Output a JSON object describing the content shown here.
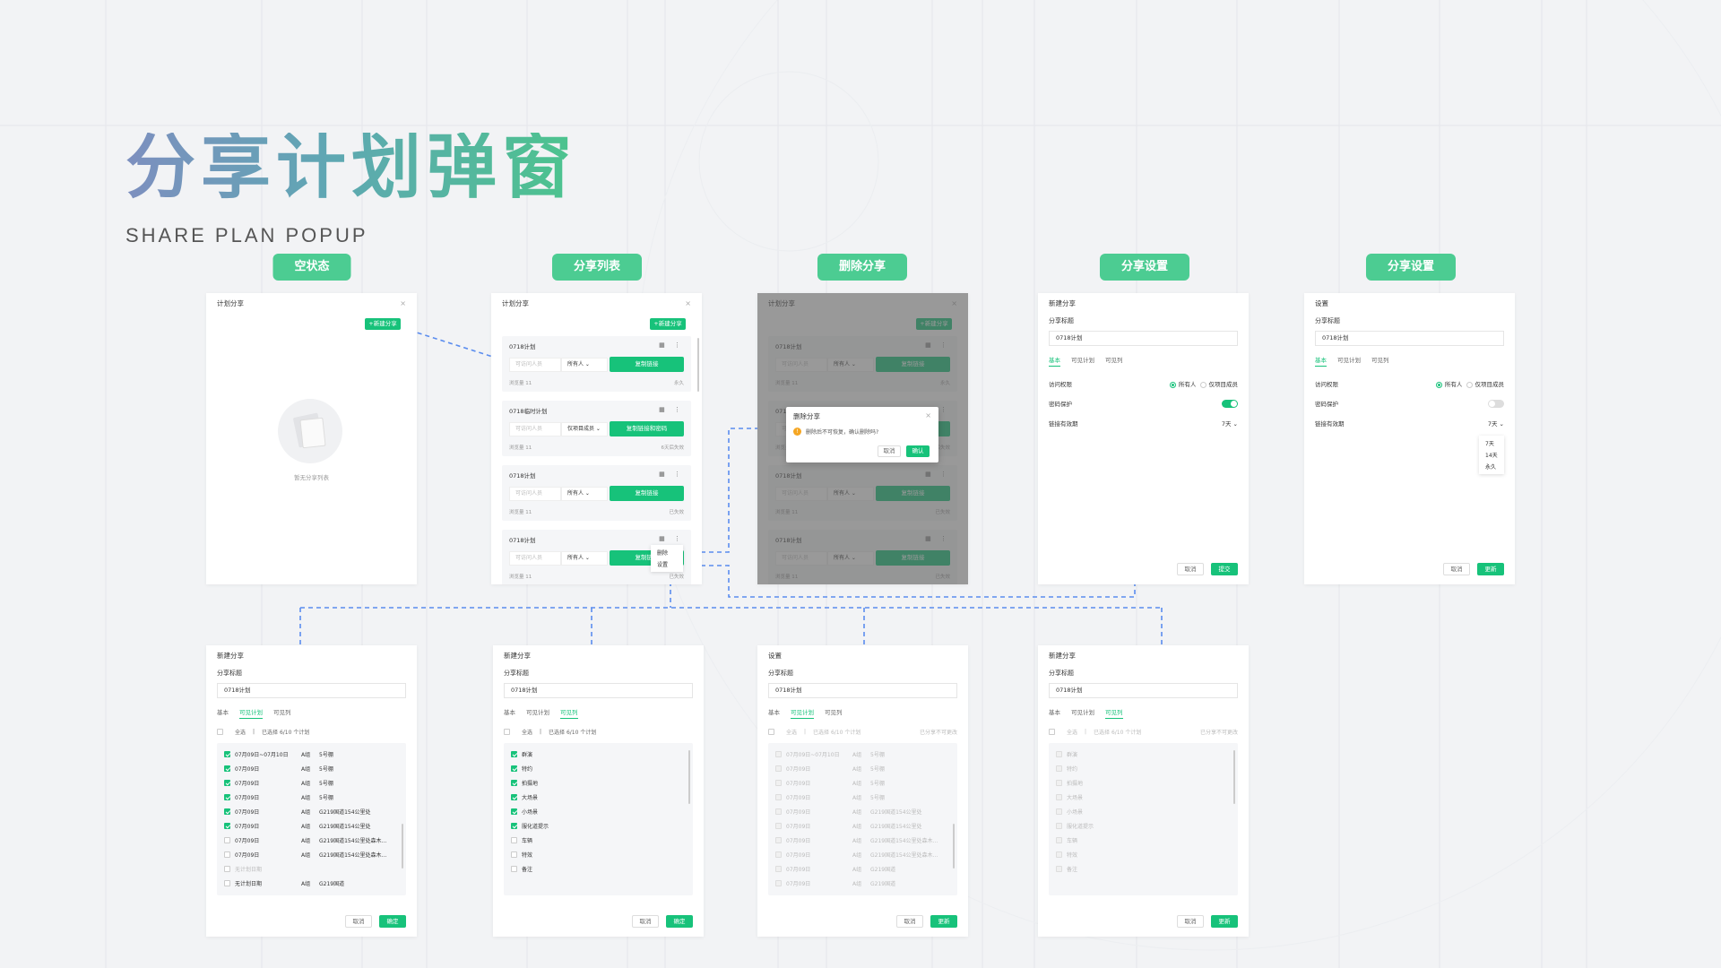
{
  "title": "分享计划弹窗",
  "subtitle": "SHARE PLAN POPUP",
  "tags": [
    "空状态",
    "分享列表",
    "删除分享",
    "分享设置",
    "分享设置"
  ],
  "colors": {
    "accent": "#17c27a",
    "tag": "#4ccc92",
    "connector": "#5b8def"
  },
  "common": {
    "plan_share": "计划分享",
    "new_share_btn": "+新建分享",
    "close": "×",
    "copy_link": "复制链接",
    "copy_link_pwd": "复制链接和密码",
    "visitor_placeholder": "可访问人员",
    "views": "浏览量 11",
    "forever": "永久",
    "days6": "6天后失效",
    "expired": "已失效",
    "cancel": "取消",
    "confirm": "确定",
    "submit": "提交",
    "update": "更新",
    "new_share": "新建分享",
    "settings": "设置",
    "share_title": "分享标题",
    "title_value": "0718计划",
    "tab_basic": "基本",
    "tab_plan": "可见计划",
    "tab_col": "可见列",
    "access": "访问权限",
    "everyone": "所有人",
    "members": "仅项目成员",
    "password": "密码保护",
    "expiry": "链接有效期",
    "days7": "7天",
    "select_all": "全选",
    "selected_6_10": "已选择 6/10 个计划",
    "selected_6_10b": "已选择 6/10 个计划",
    "edit_tip": "已分享不可更改",
    "empty": "暂无分享列表",
    "menu_delete": "删除",
    "menu_settings": "设置",
    "icons": "▦ ⋮"
  },
  "cards": [
    {
      "name": "0718计划",
      "scope": "所有人",
      "btn": "复制链接",
      "footer": "永久"
    },
    {
      "name": "0718临时计划",
      "scope": "仅项目成员",
      "btn": "复制链接和密码",
      "footer": "6天后失效"
    },
    {
      "name": "0718计划",
      "scope": "所有人",
      "btn": "复制链接",
      "footer": "已失效"
    },
    {
      "name": "0718计划",
      "scope": "所有人",
      "btn": "复制链接",
      "footer": "已失效"
    }
  ],
  "delete_dialog": {
    "title": "删除分享",
    "msg": "删除后不可恢复，确认删除吗?",
    "cancel": "取消",
    "ok": "确认"
  },
  "expiry_options": [
    "7天",
    "14天",
    "永久"
  ],
  "plans": [
    {
      "date": "07月09日~07月10日",
      "group": "A组",
      "loc": "5号棚",
      "checked": true
    },
    {
      "date": "07月09日",
      "group": "A组",
      "loc": "5号棚",
      "checked": true
    },
    {
      "date": "07月09日",
      "group": "A组",
      "loc": "5号棚",
      "checked": true
    },
    {
      "date": "07月09日",
      "group": "A组",
      "loc": "5号棚",
      "checked": true
    },
    {
      "date": "07月09日",
      "group": "A组",
      "loc": "G219国道154公里处",
      "checked": true
    },
    {
      "date": "07月09日",
      "group": "A组",
      "loc": "G219国道154公里处",
      "checked": true
    },
    {
      "date": "07月09日",
      "group": "A组",
      "loc": "G219国道154公里处森木...",
      "checked": false
    },
    {
      "date": "07月09日",
      "group": "A组",
      "loc": "G219国道154公里处森木...",
      "checked": false
    },
    {
      "date": "无计划日期",
      "group": "",
      "loc": "",
      "checked": false
    },
    {
      "date": "无计划日期",
      "group": "A组",
      "loc": "G219国道",
      "checked": false
    }
  ],
  "plans_b": [
    {
      "date": "07月09日~07月10日",
      "group": "A组",
      "loc": "5号棚"
    },
    {
      "date": "07月09日",
      "group": "A组",
      "loc": "5号棚"
    },
    {
      "date": "07月09日",
      "group": "A组",
      "loc": "5号棚"
    },
    {
      "date": "07月09日",
      "group": "A组",
      "loc": "5号棚"
    },
    {
      "date": "07月09日",
      "group": "A组",
      "loc": "G219国道154公里处"
    },
    {
      "date": "07月09日",
      "group": "A组",
      "loc": "G219国道154公里处"
    },
    {
      "date": "07月09日",
      "group": "A组",
      "loc": "G219国道154公里处森木..."
    },
    {
      "date": "07月09日",
      "group": "A组",
      "loc": "G219国道154公里处森木..."
    },
    {
      "date": "07月09日",
      "group": "A组",
      "loc": "G219国道"
    },
    {
      "date": "07月09日",
      "group": "A组",
      "loc": "G219国道"
    }
  ],
  "columns": [
    {
      "name": "群演",
      "checked": true
    },
    {
      "name": "特约",
      "checked": true
    },
    {
      "name": "拍摄地",
      "checked": true
    },
    {
      "name": "大场景",
      "checked": true
    },
    {
      "name": "小场景",
      "checked": true
    },
    {
      "name": "服化道提示",
      "checked": true
    },
    {
      "name": "车辆",
      "checked": false
    },
    {
      "name": "特效",
      "checked": false
    },
    {
      "name": "备注",
      "checked": false
    }
  ]
}
